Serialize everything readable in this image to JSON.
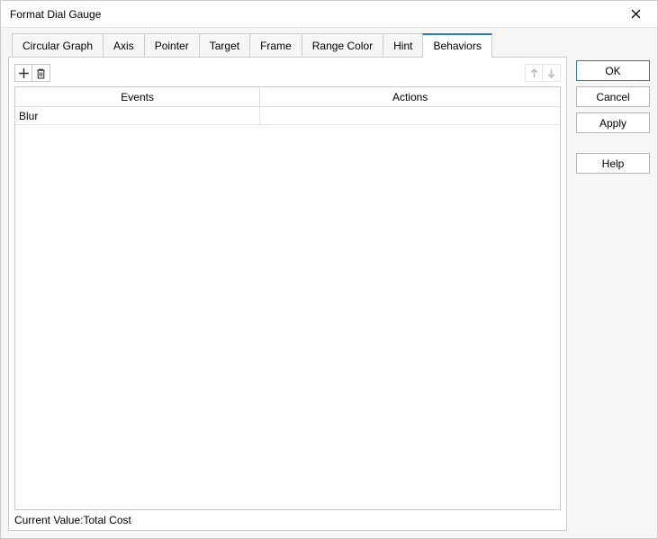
{
  "dialog": {
    "title": "Format Dial Gauge"
  },
  "tabs": {
    "items": [
      {
        "label": "Circular Graph"
      },
      {
        "label": "Axis"
      },
      {
        "label": "Pointer"
      },
      {
        "label": "Target"
      },
      {
        "label": "Frame"
      },
      {
        "label": "Range Color"
      },
      {
        "label": "Hint"
      },
      {
        "label": "Behaviors"
      }
    ],
    "active_index": 7
  },
  "grid": {
    "headers": {
      "events": "Events",
      "actions": "Actions"
    },
    "rows": [
      {
        "event": "Blur",
        "action": ""
      }
    ]
  },
  "status": {
    "prefix": "Current Value:",
    "value": "Total Cost"
  },
  "buttons": {
    "ok": "OK",
    "cancel": "Cancel",
    "apply": "Apply",
    "help": "Help"
  }
}
